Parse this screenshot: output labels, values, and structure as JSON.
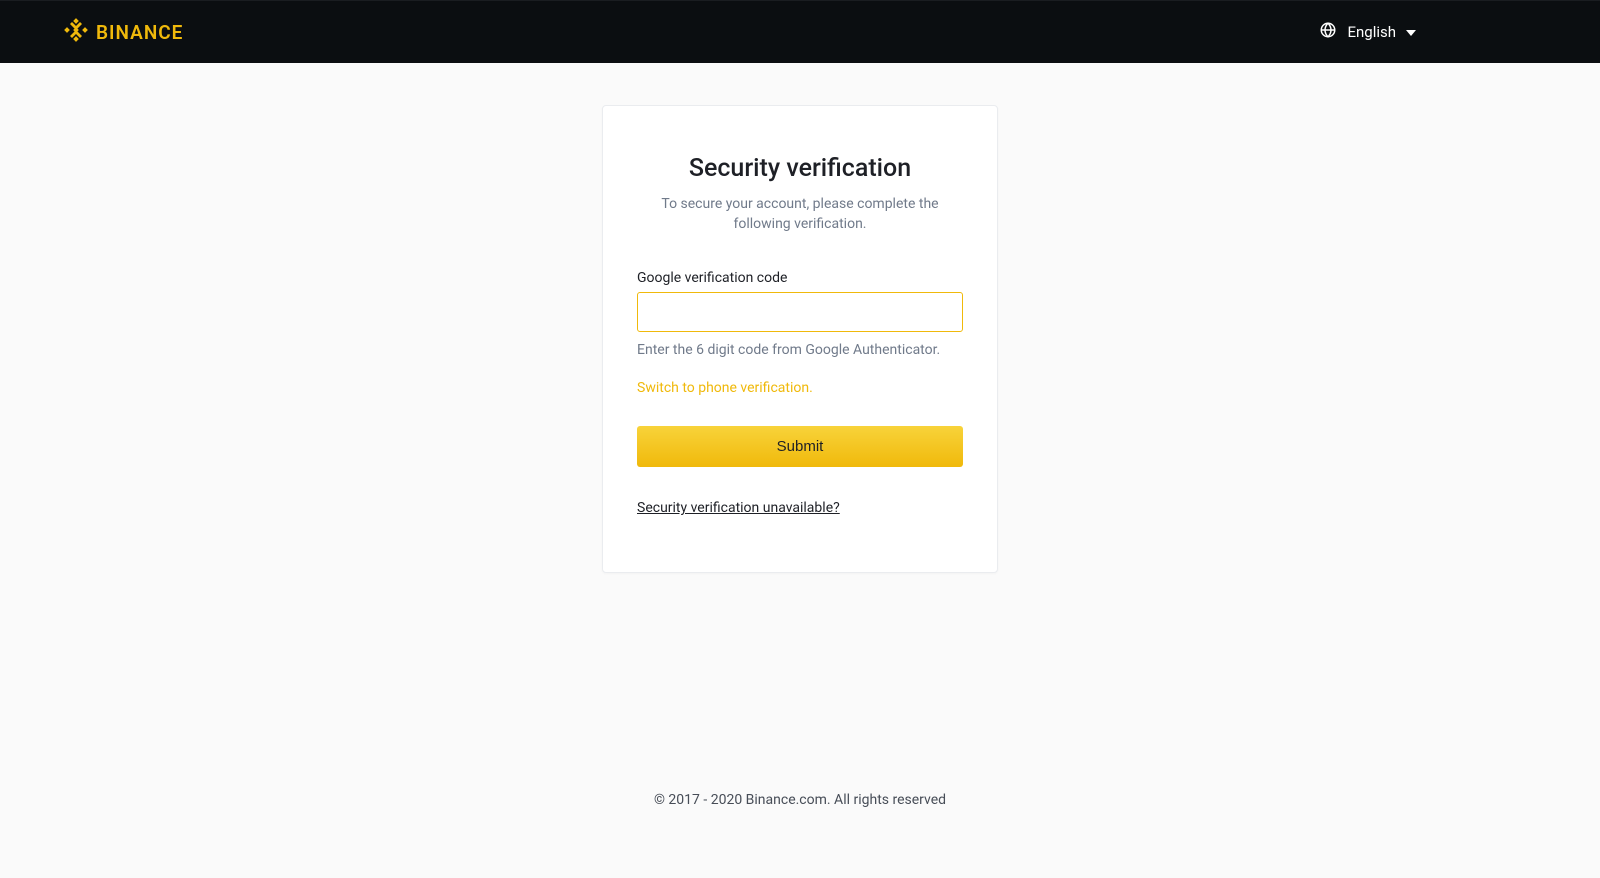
{
  "header": {
    "brand_name": "BINANCE",
    "language_label": "English"
  },
  "card": {
    "title": "Security verification",
    "subtitle": "To secure your account, please complete the following verification.",
    "field_label": "Google verification code",
    "input_value": "",
    "field_hint": "Enter the 6 digit code from Google Authenticator.",
    "switch_link": "Switch to phone verification.",
    "submit_label": "Submit",
    "unavailable_link": "Security verification unavailable?"
  },
  "footer": {
    "copyright": "© 2017 - 2020 Binance.com. All rights reserved"
  },
  "colors": {
    "brand": "#f0b90b",
    "header_bg": "#0b0e11",
    "page_bg": "#fafafa",
    "text_primary": "#1e2026",
    "text_secondary": "#707a8a"
  }
}
